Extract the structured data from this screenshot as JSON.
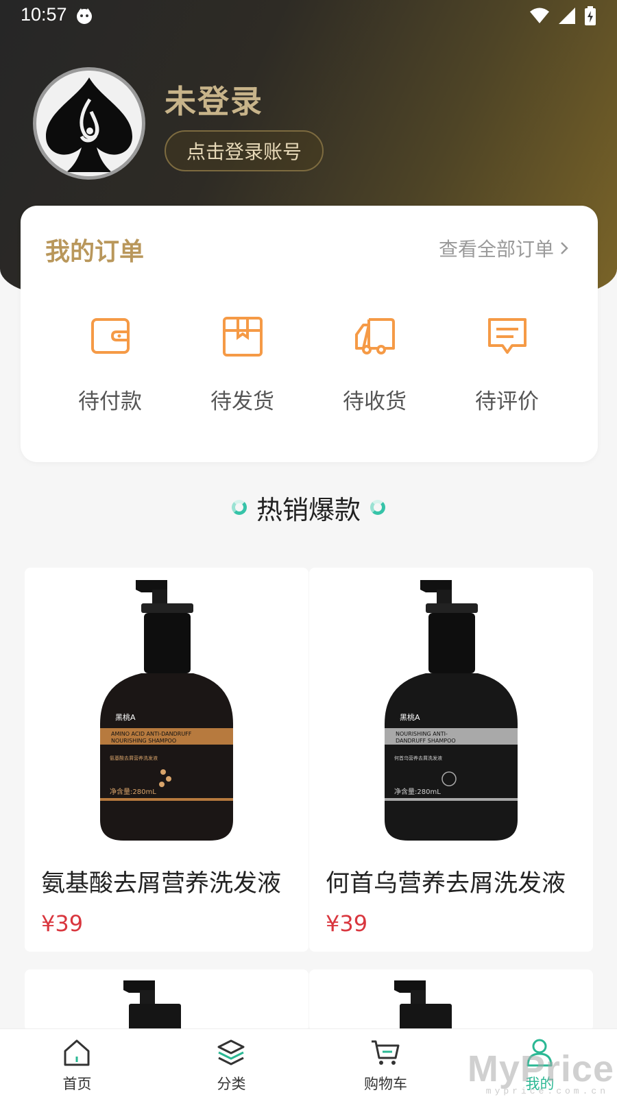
{
  "status_bar": {
    "time": "10:57"
  },
  "profile": {
    "title": "未登录",
    "login_button": "点击登录账号"
  },
  "orders": {
    "title": "我的订单",
    "view_all": "查看全部订单",
    "items": [
      {
        "label": "待付款",
        "icon": "wallet-icon"
      },
      {
        "label": "待发货",
        "icon": "package-icon"
      },
      {
        "label": "待收货",
        "icon": "truck-icon"
      },
      {
        "label": "待评价",
        "icon": "comment-icon"
      }
    ]
  },
  "hot": {
    "title": "热销爆款"
  },
  "products": [
    {
      "name": "氨基酸去屑营养洗发液",
      "price": "¥39",
      "label_brand": "黑桃A",
      "label_en_line1": "AMINO ACID ANTI-DANDRUFF",
      "label_en_line2": "NOURISHING SHAMPOO",
      "label_cn": "氨基酸去屑营养洗发液",
      "label_volume": "净含量:280mL",
      "accent": "#b77a3e"
    },
    {
      "name": "何首乌营养去屑洗发液",
      "price": "¥39",
      "label_brand": "黑桃A",
      "label_en_line1": "NOURISHING ANTI-",
      "label_en_line2": "DANDRUFF SHAMPOO",
      "label_cn": "何首乌营养去屑洗发液",
      "label_volume": "净含量:280mL",
      "accent": "#a9a9a9"
    }
  ],
  "tabbar": {
    "items": [
      {
        "label": "首页",
        "icon": "home-icon"
      },
      {
        "label": "分类",
        "icon": "layers-icon"
      },
      {
        "label": "购物车",
        "icon": "cart-icon"
      },
      {
        "label": "我的",
        "icon": "user-icon",
        "active": true
      }
    ]
  },
  "watermark": {
    "text": "MyPrice",
    "sub": "myprice.com.cn"
  },
  "colors": {
    "gold": "#b9975b",
    "order_icon": "#f59a46",
    "price": "#d9363e",
    "active_tab": "#2bb894"
  }
}
